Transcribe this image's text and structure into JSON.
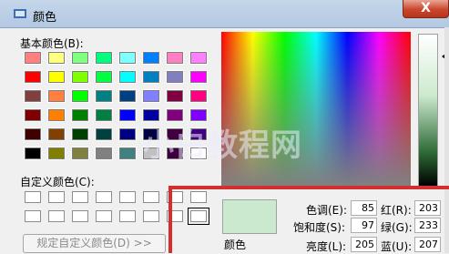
{
  "title": "颜色",
  "close_label": "X",
  "basic_colors_label": "基本颜色(B):",
  "basic_colors": [
    [
      "#ff8080",
      "#ffff80",
      "#80ff80",
      "#00ff80",
      "#80ffff",
      "#0080ff",
      "#ff80c0",
      "#ff80ff"
    ],
    [
      "#ff0000",
      "#ffff00",
      "#80ff00",
      "#00ff40",
      "#00ffff",
      "#0080c0",
      "#8080c0",
      "#ff00ff"
    ],
    [
      "#804040",
      "#ff8040",
      "#00ff00",
      "#008080",
      "#004080",
      "#8080ff",
      "#800040",
      "#ff0080"
    ],
    [
      "#800000",
      "#ff8000",
      "#008000",
      "#008040",
      "#0000ff",
      "#0000a0",
      "#800080",
      "#8000ff"
    ],
    [
      "#400000",
      "#804000",
      "#004000",
      "#004040",
      "#000080",
      "#000040",
      "#400040",
      "#400080"
    ],
    [
      "#000000",
      "#808000",
      "#808040",
      "#808080",
      "#408080",
      "#c0c0c0",
      "#400040",
      "#ffffff"
    ]
  ],
  "custom_colors_label": "自定义颜色(C):",
  "define_custom_button": "规定自定义颜色(D) >>",
  "preview_label": "颜色",
  "watermark": "小白教程网",
  "fields": {
    "hue_label": "色调(E):",
    "hue_value": "85",
    "sat_label": "饱和度(S):",
    "sat_value": "97",
    "lum_label": "亮度(L):",
    "lum_value": "205",
    "red_label": "红(R):",
    "red_value": "203",
    "green_label": "绿(G):",
    "green_value": "233",
    "blue_label": "蓝(U):",
    "blue_value": "207"
  }
}
